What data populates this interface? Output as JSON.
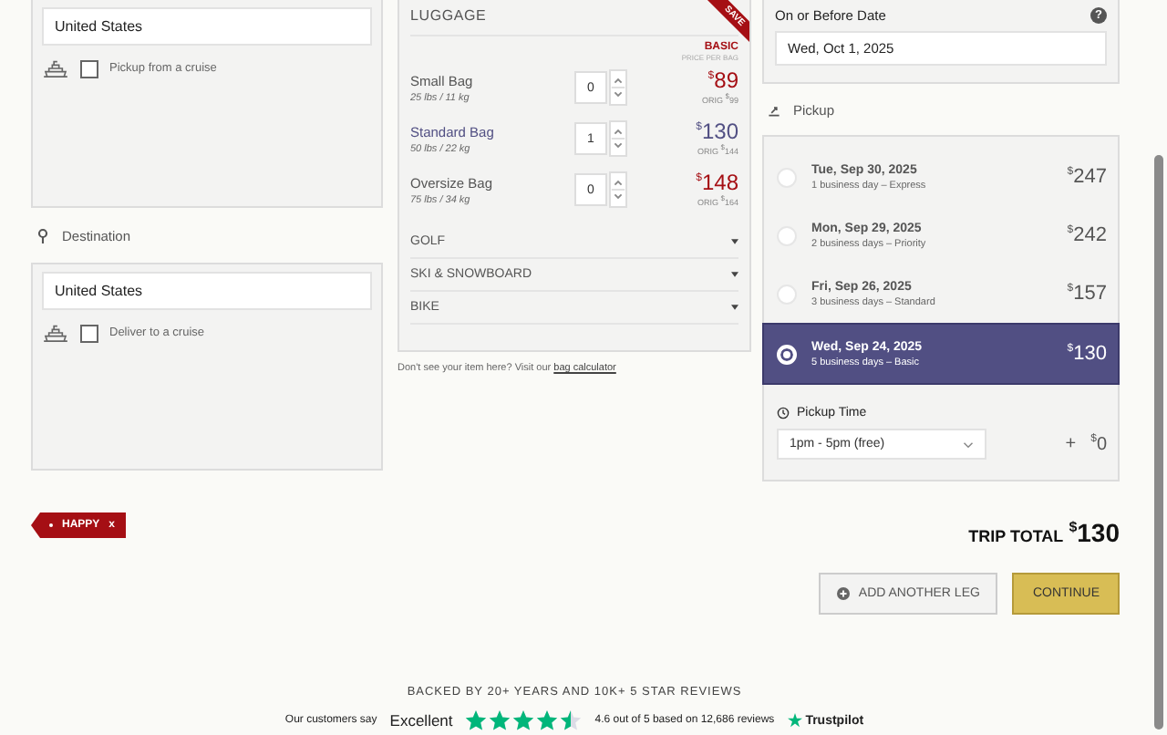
{
  "origin": {
    "country": "United States",
    "cruise_label": "Pickup from a cruise",
    "cruise_checked": false
  },
  "destination": {
    "title": "Destination",
    "country": "United States",
    "cruise_label": "Deliver to a cruise",
    "cruise_checked": false
  },
  "promo": {
    "code": "HAPPY",
    "remove": "x"
  },
  "luggage": {
    "title": "LUGGAGE",
    "ribbon": "SAVE",
    "tier": "BASIC",
    "tier_note": "PRICE PER BAG",
    "bags": [
      {
        "name": "Small Bag",
        "weight": "25 lbs / 11 kg",
        "qty": "0",
        "currency": "$",
        "price": "89",
        "orig_label": "ORIG",
        "orig_currency": "$",
        "orig": "99",
        "selected": false
      },
      {
        "name": "Standard Bag",
        "weight": "50 lbs / 22 kg",
        "qty": "1",
        "currency": "$",
        "price": "130",
        "orig_label": "ORIG",
        "orig_currency": "$",
        "orig": "144",
        "selected": true
      },
      {
        "name": "Oversize Bag",
        "weight": "75 lbs / 34 kg",
        "qty": "0",
        "currency": "$",
        "price": "148",
        "orig_label": "ORIG",
        "orig_currency": "$",
        "orig": "164",
        "selected": false
      }
    ],
    "categories": [
      {
        "label": "GOLF",
        "expanded": false
      },
      {
        "label": "SKI & SNOWBOARD",
        "expanded": false
      },
      {
        "label": "BIKE",
        "expanded": false
      }
    ],
    "hint": "Don't see your item here? Visit our",
    "hint_link": "bag calculator"
  },
  "date": {
    "label": "On or Before Date",
    "value": "Wed, Oct 1, 2025",
    "help": "?"
  },
  "pickup": {
    "title": "Pickup",
    "options": [
      {
        "date": "Tue, Sep 30, 2025",
        "detail": "1 business day – Express",
        "currency": "$",
        "price": "247",
        "selected": false
      },
      {
        "date": "Mon, Sep 29, 2025",
        "detail": "2 business days – Priority",
        "currency": "$",
        "price": "242",
        "selected": false
      },
      {
        "date": "Fri, Sep 26, 2025",
        "detail": "3 business days – Standard",
        "currency": "$",
        "price": "157",
        "selected": false
      },
      {
        "date": "Wed, Sep 24, 2025",
        "detail": "5 business days – Basic",
        "currency": "$",
        "price": "130",
        "selected": true
      }
    ],
    "time_label": "Pickup Time",
    "time_value": "1pm - 5pm (free)",
    "plus": "+",
    "time_currency": "$",
    "time_price": "0"
  },
  "total": {
    "label": "TRIP TOTAL",
    "currency": "$",
    "amount": "130"
  },
  "buttons": {
    "add_leg": "ADD ANOTHER LEG",
    "continue": "CONTINUE"
  },
  "reviews": {
    "heading": "BACKED BY 20+ YEARS AND 10K+ 5 STAR REVIEWS",
    "say": "Our customers say",
    "rating_word": "Excellent",
    "stars": 4.5,
    "summary": "4.6 out of 5 based on 12,686 reviews",
    "brand": "Trustpilot"
  }
}
